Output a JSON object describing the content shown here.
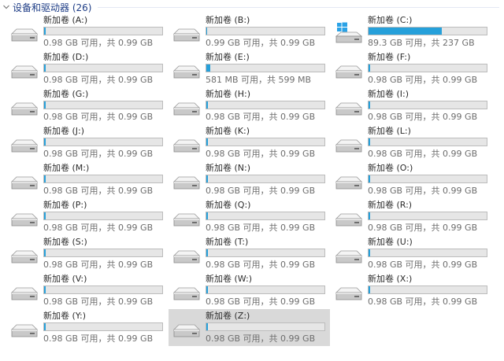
{
  "group": {
    "title": "设备和驱动器 (26)"
  },
  "drives": [
    {
      "label": "新加卷 (A:)",
      "info": "0.98 GB 可用，共 0.99 GB",
      "used_fraction": 0.01,
      "icon": "drive-icon"
    },
    {
      "label": "新加卷 (B:)",
      "info": "0.99 GB 可用，共 0.99 GB",
      "used_fraction": 0.0,
      "icon": "drive-icon"
    },
    {
      "label": "新加卷 (C:)",
      "info": "89.3 GB 可用，共 237 GB",
      "used_fraction": 0.62,
      "icon": "windows-drive-icon"
    },
    {
      "label": "新加卷 (D:)",
      "info": "0.98 GB 可用，共 0.99 GB",
      "used_fraction": 0.01,
      "icon": "drive-icon"
    },
    {
      "label": "新加卷 (E:)",
      "info": "581 MB 可用，共 599 MB",
      "used_fraction": 0.03,
      "icon": "drive-icon"
    },
    {
      "label": "新加卷 (F:)",
      "info": "0.98 GB 可用，共 0.99 GB",
      "used_fraction": 0.01,
      "icon": "drive-icon"
    },
    {
      "label": "新加卷 (G:)",
      "info": "0.98 GB 可用，共 0.99 GB",
      "used_fraction": 0.01,
      "icon": "drive-icon"
    },
    {
      "label": "新加卷 (H:)",
      "info": "0.98 GB 可用，共 0.99 GB",
      "used_fraction": 0.01,
      "icon": "drive-icon"
    },
    {
      "label": "新加卷 (I:)",
      "info": "0.98 GB 可用，共 0.99 GB",
      "used_fraction": 0.01,
      "icon": "drive-icon"
    },
    {
      "label": "新加卷 (J:)",
      "info": "0.98 GB 可用，共 0.99 GB",
      "used_fraction": 0.01,
      "icon": "drive-icon"
    },
    {
      "label": "新加卷 (K:)",
      "info": "0.98 GB 可用，共 0.99 GB",
      "used_fraction": 0.01,
      "icon": "drive-icon"
    },
    {
      "label": "新加卷 (L:)",
      "info": "0.98 GB 可用，共 0.99 GB",
      "used_fraction": 0.01,
      "icon": "drive-icon"
    },
    {
      "label": "新加卷 (M:)",
      "info": "0.98 GB 可用，共 0.99 GB",
      "used_fraction": 0.01,
      "icon": "drive-icon"
    },
    {
      "label": "新加卷 (N:)",
      "info": "0.98 GB 可用，共 0.99 GB",
      "used_fraction": 0.01,
      "icon": "drive-icon"
    },
    {
      "label": "新加卷 (O:)",
      "info": "0.98 GB 可用，共 0.99 GB",
      "used_fraction": 0.01,
      "icon": "drive-icon"
    },
    {
      "label": "新加卷 (P:)",
      "info": "0.98 GB 可用，共 0.99 GB",
      "used_fraction": 0.01,
      "icon": "drive-icon"
    },
    {
      "label": "新加卷 (Q:)",
      "info": "0.98 GB 可用，共 0.99 GB",
      "used_fraction": 0.01,
      "icon": "drive-icon"
    },
    {
      "label": "新加卷 (R:)",
      "info": "0.98 GB 可用，共 0.99 GB",
      "used_fraction": 0.01,
      "icon": "drive-icon"
    },
    {
      "label": "新加卷 (S:)",
      "info": "0.98 GB 可用，共 0.99 GB",
      "used_fraction": 0.01,
      "icon": "drive-icon"
    },
    {
      "label": "新加卷 (T:)",
      "info": "0.98 GB 可用，共 0.99 GB",
      "used_fraction": 0.01,
      "icon": "drive-icon"
    },
    {
      "label": "新加卷 (U:)",
      "info": "0.98 GB 可用，共 0.99 GB",
      "used_fraction": 0.01,
      "icon": "drive-icon"
    },
    {
      "label": "新加卷 (V:)",
      "info": "0.98 GB 可用，共 0.99 GB",
      "used_fraction": 0.01,
      "icon": "drive-icon"
    },
    {
      "label": "新加卷 (W:)",
      "info": "0.98 GB 可用，共 0.99 GB",
      "used_fraction": 0.01,
      "icon": "drive-icon"
    },
    {
      "label": "新加卷 (X:)",
      "info": "0.98 GB 可用，共 0.99 GB",
      "used_fraction": 0.01,
      "icon": "drive-icon"
    },
    {
      "label": "新加卷 (Y:)",
      "info": "0.98 GB 可用，共 0.99 GB",
      "used_fraction": 0.01,
      "icon": "drive-icon"
    },
    {
      "label": "新加卷 (Z:)",
      "info": "0.98 GB 可用，共 0.99 GB",
      "used_fraction": 0.01,
      "icon": "drive-icon",
      "selected": true
    }
  ],
  "colors": {
    "accent": "#26a0da",
    "header_text": "#1e3d86",
    "selection": "#d9d9d9"
  }
}
